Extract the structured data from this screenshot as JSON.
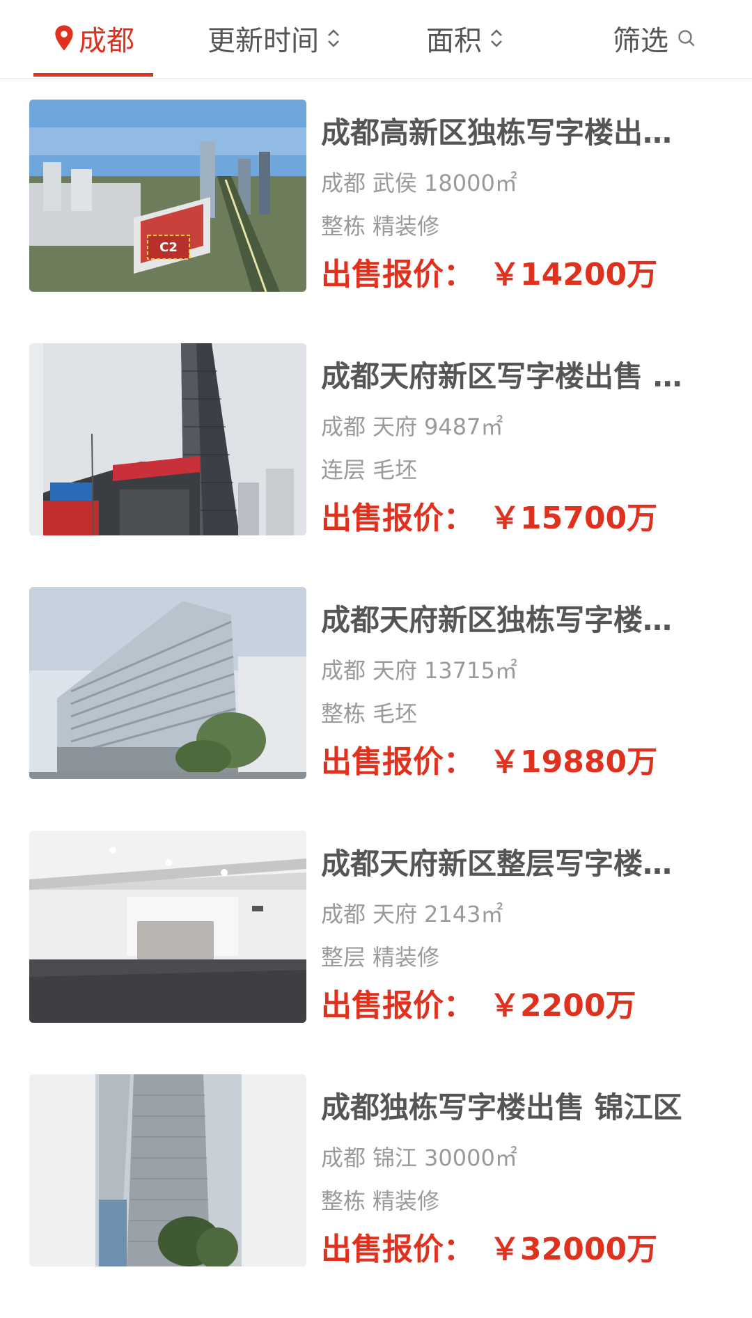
{
  "topbar": {
    "city": "成都",
    "sort_time": "更新时间",
    "sort_area": "面积",
    "filter": "筛选"
  },
  "colors": {
    "accent": "#e0301e",
    "title": "#555555",
    "meta": "#9a9a9a"
  },
  "listings": [
    {
      "title": "成都高新区独栋写字楼出售 武侯",
      "city": "成都",
      "district": "武侯",
      "area": "18000㎡",
      "type": "整栋",
      "decoration": "精装修",
      "price_label": "出售报价：",
      "price": "￥14200万",
      "image": "aerial-campus-photo"
    },
    {
      "title": "成都天府新区写字楼出售 天府",
      "city": "成都",
      "district": "天府",
      "area": "9487㎡",
      "type": "连层",
      "decoration": "毛坯",
      "price_label": "出售报价：",
      "price": "￥15700万",
      "image": "tower-photo"
    },
    {
      "title": "成都天府新区独栋写字楼出售",
      "city": "成都",
      "district": "天府",
      "area": "13715㎡",
      "type": "整栋",
      "decoration": "毛坯",
      "price_label": "出售报价：",
      "price": "￥19880万",
      "image": "office-building-photo"
    },
    {
      "title": "成都天府新区整层写字楼出售",
      "city": "成都",
      "district": "天府",
      "area": "2143㎡",
      "type": "整层",
      "decoration": "精装修",
      "price_label": "出售报价：",
      "price": "￥2200万",
      "image": "office-lobby-photo"
    },
    {
      "title": "成都独栋写字楼出售 锦江区",
      "city": "成都",
      "district": "锦江",
      "area": "30000㎡",
      "type": "整栋",
      "decoration": "精装修",
      "price_label": "出售报价：",
      "price": "￥32000万",
      "image": "highrise-photo"
    }
  ]
}
